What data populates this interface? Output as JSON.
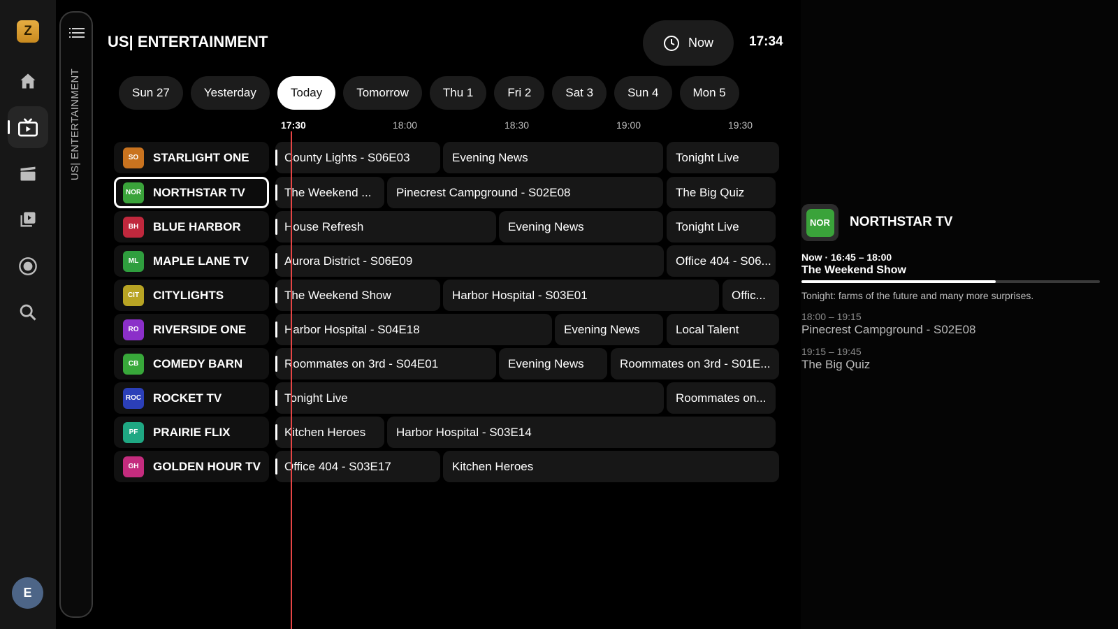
{
  "app": {
    "logo_letter": "Z",
    "user_initial": "E"
  },
  "nav": [
    "home-icon",
    "live-tv-icon",
    "movies-icon",
    "series-icon",
    "record-icon",
    "search-icon"
  ],
  "category": "US| ENTERTAINMENT",
  "header": {
    "title": "US| ENTERTAINMENT",
    "now_label": "Now",
    "time": "17:34"
  },
  "dates": [
    "Sun 27",
    "Yesterday",
    "Today",
    "Tomorrow",
    "Thu 1",
    "Fri 2",
    "Sat 3",
    "Sun 4",
    "Mon 5"
  ],
  "selected_date": "Today",
  "timeline": [
    "17:30",
    "18:00",
    "18:30",
    "19:00",
    "19:30"
  ],
  "channels": [
    {
      "abbr": "SO",
      "name": "STARLIGHT ONE",
      "color": "#c9731f",
      "programs": [
        "County Lights - S06E03",
        "Evening News",
        "Tonight Live"
      ]
    },
    {
      "abbr": "NOR",
      "name": "NORTHSTAR TV",
      "color": "#3aa33a",
      "programs": [
        "The Weekend ...",
        "Pinecrest Campground - S02E08",
        "The Big Quiz"
      ]
    },
    {
      "abbr": "BH",
      "name": "BLUE HARBOR",
      "color": "#c0283d",
      "programs": [
        "House Refresh",
        "Evening News",
        "Tonight Live"
      ]
    },
    {
      "abbr": "ML",
      "name": "MAPLE LANE TV",
      "color": "#2f9e3e",
      "programs": [
        "Aurora District - S06E09",
        "Office 404 - S06..."
      ]
    },
    {
      "abbr": "CIT",
      "name": "CITYLIGHTS",
      "color": "#b8a424",
      "programs": [
        "The Weekend Show",
        "Harbor Hospital - S03E01",
        "Offic..."
      ]
    },
    {
      "abbr": "RO",
      "name": "RIVERSIDE ONE",
      "color": "#8b2fc9",
      "programs": [
        "Harbor Hospital - S04E18",
        "Evening News",
        "Local Talent"
      ]
    },
    {
      "abbr": "CB",
      "name": "COMEDY BARN",
      "color": "#38a83a",
      "programs": [
        "Roommates on 3rd - S04E01",
        "Evening News",
        "Roommates on 3rd - S01E..."
      ]
    },
    {
      "abbr": "ROC",
      "name": "ROCKET TV",
      "color": "#2b3fb8",
      "programs": [
        "Tonight Live",
        "Roommates on..."
      ]
    },
    {
      "abbr": "PF",
      "name": "PRAIRIE FLIX",
      "color": "#1fa883",
      "programs": [
        "Kitchen Heroes",
        "Harbor Hospital - S03E14"
      ]
    },
    {
      "abbr": "GH",
      "name": "GOLDEN HOUR TV",
      "color": "#c42c7e",
      "programs": [
        "Office 404 - S03E17",
        "Kitchen Heroes"
      ]
    }
  ],
  "selected_channel": "NORTHSTAR TV",
  "panel": {
    "logo": "NOR",
    "channel": "NORTHSTAR TV",
    "now_time": "Now · 16:45 – 18:00",
    "now_title": "The Weekend Show",
    "progress_fraction": 0.65,
    "description": "Tonight: farms of the future and many more surprises.",
    "upcoming": [
      {
        "time": "18:00 – 19:15",
        "title": "Pinecrest Campground - S02E08"
      },
      {
        "time": "19:15 – 19:45",
        "title": "The Big Quiz"
      }
    ]
  }
}
